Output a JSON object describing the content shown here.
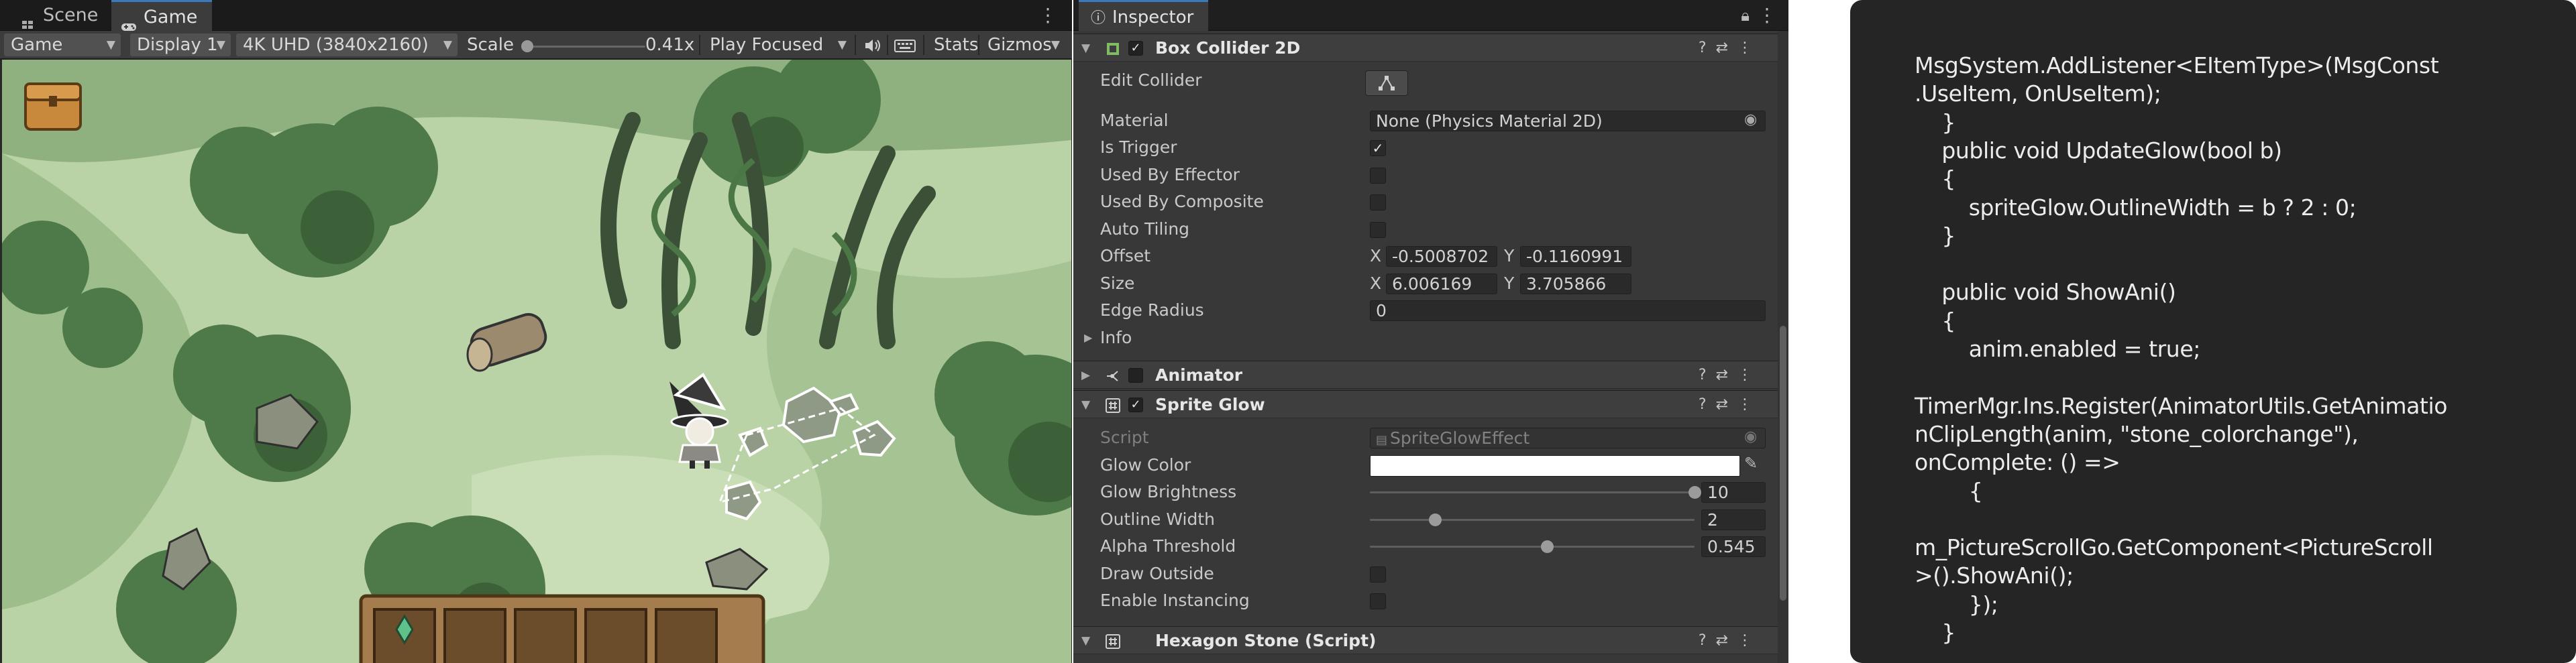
{
  "game_view": {
    "tabs": [
      {
        "label": "Scene"
      },
      {
        "label": "Game"
      }
    ],
    "toolbar": {
      "view_dropdown": "Game",
      "display_dropdown": "Display 1",
      "resolution_dropdown": "4K UHD (3840x2160)",
      "scale_label": "Scale",
      "scale_value": "0.41x",
      "scale_fraction": 0.02,
      "play_mode_dropdown": "Play Focused",
      "stats_label": "Stats",
      "gizmos_label": "Gizmos"
    }
  },
  "inspector": {
    "tab_label": "Inspector",
    "box_collider": {
      "title": "Box Collider 2D",
      "enabled": true,
      "edit_collider_label": "Edit Collider",
      "material_label": "Material",
      "material_value": "None (Physics Material 2D)",
      "is_trigger_label": "Is Trigger",
      "is_trigger": true,
      "used_by_effector_label": "Used By Effector",
      "used_by_effector": false,
      "used_by_composite_label": "Used By Composite",
      "used_by_composite": false,
      "auto_tiling_label": "Auto Tiling",
      "auto_tiling": false,
      "offset_label": "Offset",
      "offset_x": "-0.5008702",
      "offset_y": "-0.1160991",
      "size_label": "Size",
      "size_x": "6.006169",
      "size_y": "3.705866",
      "x_label": "X",
      "y_label": "Y",
      "edge_radius_label": "Edge Radius",
      "edge_radius_value": "0",
      "info_label": "Info"
    },
    "animator": {
      "title": "Animator",
      "enabled": false
    },
    "sprite_glow": {
      "title": "Sprite Glow",
      "enabled": true,
      "script_label": "Script",
      "script_value": "SpriteGlowEffect",
      "glow_color_label": "Glow Color",
      "glow_color": "#ffffff",
      "glow_brightness_label": "Glow Brightness",
      "glow_brightness_value": "10",
      "glow_brightness_fraction": 1.0,
      "outline_width_label": "Outline Width",
      "outline_width_value": "2",
      "outline_width_fraction": 0.2,
      "alpha_threshold_label": "Alpha Threshold",
      "alpha_threshold_value": "0.545",
      "alpha_threshold_fraction": 0.545,
      "draw_outside_label": "Draw Outside",
      "draw_outside": false,
      "enable_instancing_label": "Enable Instancing",
      "enable_instancing": false
    },
    "hexagon_stone": {
      "title": "Hexagon Stone (Script)"
    }
  },
  "code": {
    "lines": [
      "MsgSystem.AddListener<EItemType>(MsgConst",
      ".UseItem, OnUseItem);",
      "    }",
      "    public void UpdateGlow(bool b)",
      "    {",
      "        spriteGlow.OutlineWidth = b ? 2 : 0;",
      "    }",
      "",
      "    public void ShowAni()",
      "    {",
      "        anim.enabled = true;",
      "",
      "TimerMgr.Ins.Register(AnimatorUtils.GetAnimatio",
      "nClipLength(anim, \"stone_colorchange\"),",
      "onComplete: () =>",
      "        {",
      "",
      "m_PictureScrollGo.GetComponent<PictureScroll",
      ">().ShowAni();",
      "        });",
      "    }"
    ]
  },
  "colors": {
    "editor_bg": "#383838",
    "toolbar_bg": "#3c3c3c",
    "accent_blue": "#3a79bb",
    "code_bg": "#252525",
    "scene_grass": "#c3d9b1",
    "scene_dark_grass": "#a4c291"
  }
}
